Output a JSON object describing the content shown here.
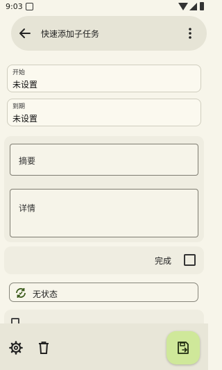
{
  "status_bar": {
    "time": "9:03"
  },
  "top_bar": {
    "title": "快速添加子任务"
  },
  "start": {
    "label": "开始",
    "value": "未设置"
  },
  "due": {
    "label": "到期",
    "value": "未设置"
  },
  "summary": {
    "placeholder": "摘要"
  },
  "details": {
    "placeholder": "详情"
  },
  "completion": {
    "label": "完成",
    "checked": false
  },
  "status_chip": {
    "label": "无状态"
  },
  "icons": {
    "back": "arrow-back-icon",
    "more": "more-vert-icon",
    "status": "sync-icon",
    "settings": "gear-icon",
    "delete": "trash-icon",
    "save": "save-icon"
  },
  "colors": {
    "background": "#f7f5ea",
    "fab": "#cfe89a",
    "top_bar": "#e6e4d6"
  }
}
